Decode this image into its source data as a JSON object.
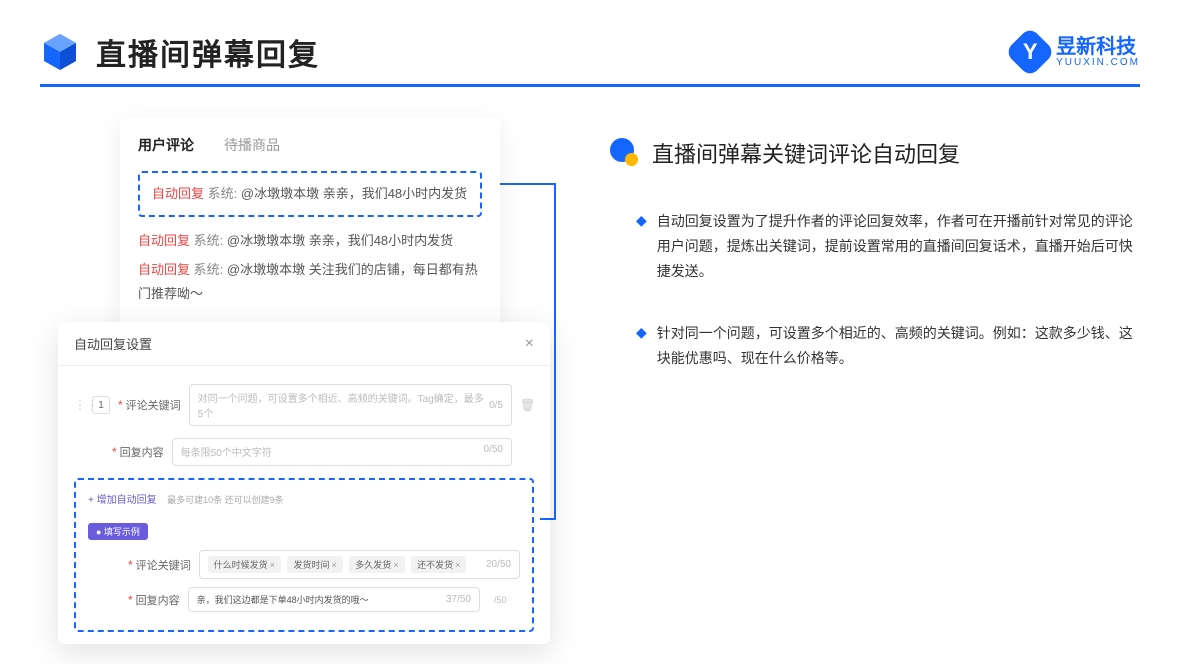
{
  "header": {
    "title": "直播间弹幕回复",
    "brand_name": "昱新科技",
    "brand_sub": "YUUXIN.COM",
    "brand_letter": "Y"
  },
  "comments_card": {
    "tab_active": "用户评论",
    "tab_inactive": "待播商品",
    "highlight": {
      "auto_reply": "自动回复",
      "system": "系统:",
      "text": "@冰墩墩本墩 亲亲，我们48小时内发货"
    },
    "items": [
      {
        "auto_reply": "自动回复",
        "system": "系统:",
        "text": "@冰墩墩本墩 亲亲，我们48小时内发货"
      },
      {
        "auto_reply": "自动回复",
        "system": "系统:",
        "text": "@冰墩墩本墩 关注我们的店铺，每日都有热门推荐呦～"
      }
    ]
  },
  "settings_card": {
    "title": "自动回复设置",
    "row_num": "1",
    "keyword_label": "评论关键词",
    "keyword_placeholder": "对同一个问题，可设置多个相近、高频的关键词。Tag确定，最多5个",
    "keyword_counter": "0/5",
    "content_label": "回复内容",
    "content_placeholder": "每条限50个中文字符",
    "content_counter": "0/50",
    "add_link": "+ 增加自动回复",
    "add_hint": "最多可建10条 还可以创建9条",
    "example_badge": "● 填写示例",
    "example_keyword_label": "评论关键词",
    "example_tags": [
      "什么时候发货",
      "发货时间",
      "多久发货",
      "还不发货"
    ],
    "example_keyword_counter": "20/50",
    "example_content_label": "回复内容",
    "example_content_text": "亲，我们这边都是下单48小时内发货的哦～",
    "example_content_counter": "37/50",
    "outer_counter": "/50"
  },
  "right": {
    "section_title": "直播间弹幕关键词评论自动回复",
    "bullets": [
      "自动回复设置为了提升作者的评论回复效率，作者可在开播前针对常见的评论用户问题，提炼出关键词，提前设置常用的直播间回复话术，直播开始后可快捷发送。",
      "针对同一个问题，可设置多个相近的、高频的关键词。例如：这款多少钱、这块能优惠吗、现在什么价格等。"
    ]
  }
}
